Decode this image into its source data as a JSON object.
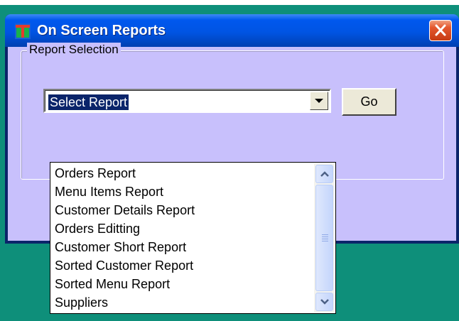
{
  "window": {
    "title": "On Screen Reports",
    "colors": {
      "titlebar": "#0054e3",
      "client": "#c8c0fc",
      "close": "#e4572e",
      "desktop": "#0e8f7a"
    },
    "icons": {
      "app": "app-icon",
      "close": "close-icon"
    }
  },
  "group": {
    "label": "Report Selection"
  },
  "combo": {
    "selected": "Select Report",
    "options": [
      "Orders Report",
      "Menu Items Report",
      "Customer Details Report",
      "Orders Editting",
      "Customer Short Report",
      "Sorted Customer Report",
      "Sorted Menu Report",
      "Suppliers"
    ]
  },
  "buttons": {
    "go": "Go"
  }
}
